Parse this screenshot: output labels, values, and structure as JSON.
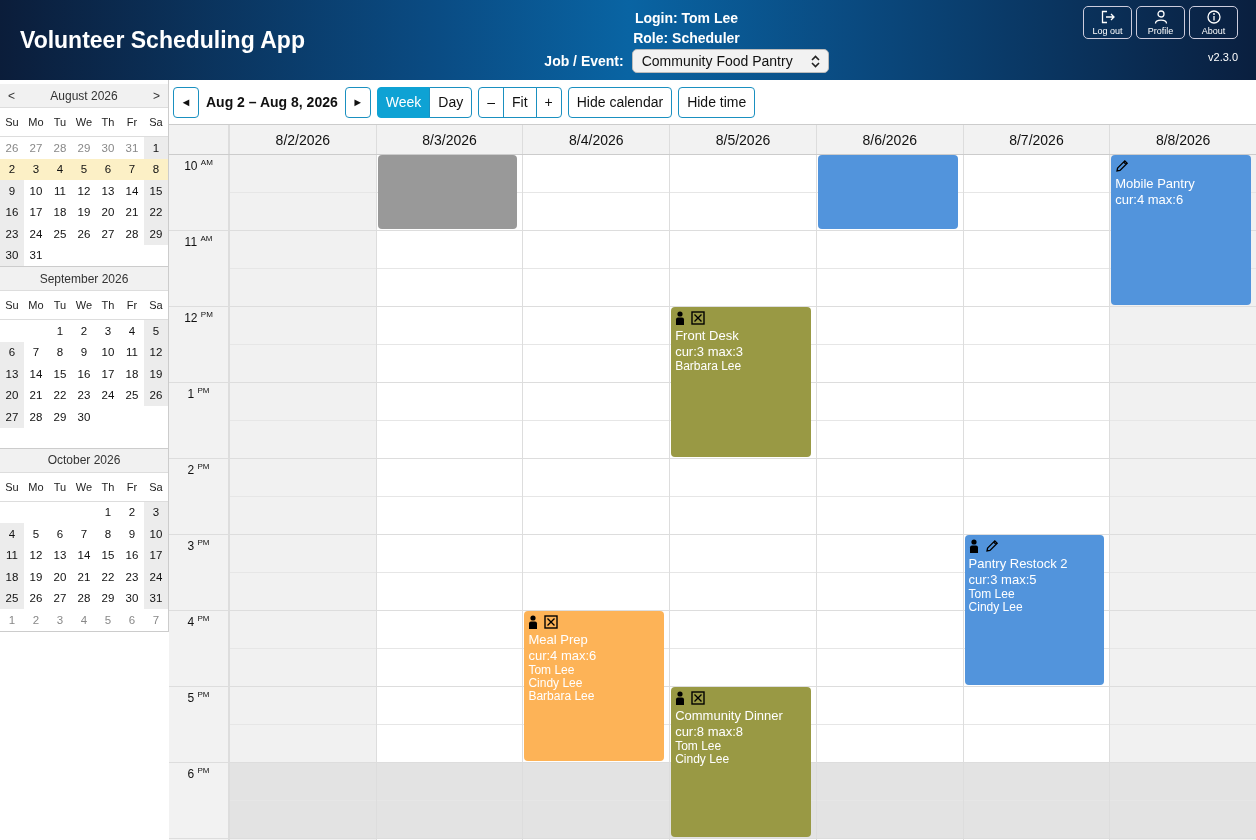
{
  "header": {
    "title": "Volunteer Scheduling App",
    "login": "Login: Tom Lee",
    "role": "Role: Scheduler",
    "job_label": "Job / Event:",
    "job_value": "Community Food Pantry",
    "buttons": [
      {
        "kind": "logout",
        "label": "Log out"
      },
      {
        "kind": "profile",
        "label": "Profile"
      },
      {
        "kind": "about",
        "label": "About"
      }
    ],
    "version": "v2.3.0"
  },
  "mini_calendars": [
    {
      "title": "August 2026",
      "prev": "<",
      "next": ">",
      "weekdays": [
        "Su",
        "Mo",
        "Tu",
        "We",
        "Th",
        "Fr",
        "Sa"
      ],
      "weeks": [
        {
          "selected": false,
          "kind": "week",
          "days": [
            {
              "label": "26",
              "other_month": true
            },
            {
              "label": "27",
              "other_month": true
            },
            {
              "label": "28",
              "other_month": true
            },
            {
              "label": "29",
              "other_month": true
            },
            {
              "label": "30",
              "other_month": true
            },
            {
              "label": "31",
              "other_month": true
            },
            {
              "label": "1",
              "other_month": false
            }
          ]
        },
        {
          "selected": true,
          "kind": "week",
          "days": [
            {
              "label": "2",
              "other_month": false
            },
            {
              "label": "3",
              "other_month": false
            },
            {
              "label": "4",
              "other_month": false
            },
            {
              "label": "5",
              "other_month": false
            },
            {
              "label": "6",
              "other_month": false
            },
            {
              "label": "7",
              "other_month": false
            },
            {
              "label": "8",
              "other_month": false
            }
          ]
        },
        {
          "selected": false,
          "kind": "week",
          "days": [
            {
              "label": "9",
              "other_month": false
            },
            {
              "label": "10",
              "other_month": false
            },
            {
              "label": "11",
              "other_month": false
            },
            {
              "label": "12",
              "other_month": false
            },
            {
              "label": "13",
              "other_month": false
            },
            {
              "label": "14",
              "other_month": false
            },
            {
              "label": "15",
              "other_month": false
            }
          ]
        },
        {
          "selected": false,
          "kind": "week",
          "days": [
            {
              "label": "16",
              "other_month": false
            },
            {
              "label": "17",
              "other_month": false
            },
            {
              "label": "18",
              "other_month": false
            },
            {
              "label": "19",
              "other_month": false
            },
            {
              "label": "20",
              "other_month": false
            },
            {
              "label": "21",
              "other_month": false
            },
            {
              "label": "22",
              "other_month": false
            }
          ]
        },
        {
          "selected": false,
          "kind": "week",
          "days": [
            {
              "label": "23",
              "other_month": false
            },
            {
              "label": "24",
              "other_month": false
            },
            {
              "label": "25",
              "other_month": false
            },
            {
              "label": "26",
              "other_month": false
            },
            {
              "label": "27",
              "other_month": false
            },
            {
              "label": "28",
              "other_month": false
            },
            {
              "label": "29",
              "other_month": false
            }
          ]
        },
        {
          "selected": false,
          "kind": "week",
          "days": [
            {
              "label": "30",
              "other_month": false
            },
            {
              "label": "31",
              "other_month": false
            }
          ]
        }
      ]
    },
    {
      "title": "September 2026",
      "weekdays": [
        "Su",
        "Mo",
        "Tu",
        "We",
        "Th",
        "Fr",
        "Sa"
      ],
      "weeks": [
        {
          "selected": false,
          "kind": "padded",
          "days": [
            {
              "label": "1",
              "other_month": false
            },
            {
              "label": "2",
              "other_month": false
            },
            {
              "label": "3",
              "other_month": false
            },
            {
              "label": "4",
              "other_month": false
            },
            {
              "label": "5",
              "other_month": false
            }
          ]
        },
        {
          "selected": false,
          "kind": "week",
          "days": [
            {
              "label": "6",
              "other_month": false
            },
            {
              "label": "7",
              "other_month": false
            },
            {
              "label": "8",
              "other_month": false
            },
            {
              "label": "9",
              "other_month": false
            },
            {
              "label": "10",
              "other_month": false
            },
            {
              "label": "11",
              "other_month": false
            },
            {
              "label": "12",
              "other_month": false
            }
          ]
        },
        {
          "selected": false,
          "kind": "week",
          "days": [
            {
              "label": "13",
              "other_month": false
            },
            {
              "label": "14",
              "other_month": false
            },
            {
              "label": "15",
              "other_month": false
            },
            {
              "label": "16",
              "other_month": false
            },
            {
              "label": "17",
              "other_month": false
            },
            {
              "label": "18",
              "other_month": false
            },
            {
              "label": "19",
              "other_month": false
            }
          ]
        },
        {
          "selected": false,
          "kind": "week",
          "days": [
            {
              "label": "20",
              "other_month": false
            },
            {
              "label": "21",
              "other_month": false
            },
            {
              "label": "22",
              "other_month": false
            },
            {
              "label": "23",
              "other_month": false
            },
            {
              "label": "24",
              "other_month": false
            },
            {
              "label": "25",
              "other_month": false
            },
            {
              "label": "26",
              "other_month": false
            }
          ]
        },
        {
          "selected": false,
          "kind": "week",
          "days": [
            {
              "label": "27",
              "other_month": false
            },
            {
              "label": "28",
              "other_month": false
            },
            {
              "label": "29",
              "other_month": false
            },
            {
              "label": "30",
              "other_month": false
            }
          ]
        }
      ]
    },
    {
      "title": "October 2026",
      "weekdays": [
        "Su",
        "Mo",
        "Tu",
        "We",
        "Th",
        "Fr",
        "Sa"
      ],
      "weeks": [
        {
          "selected": false,
          "kind": "padded",
          "days": [
            {
              "label": "1",
              "other_month": false
            },
            {
              "label": "2",
              "other_month": false
            },
            {
              "label": "3",
              "other_month": false
            }
          ]
        },
        {
          "selected": false,
          "kind": "week",
          "days": [
            {
              "label": "4",
              "other_month": false
            },
            {
              "label": "5",
              "other_month": false
            },
            {
              "label": "6",
              "other_month": false
            },
            {
              "label": "7",
              "other_month": false
            },
            {
              "label": "8",
              "other_month": false
            },
            {
              "label": "9",
              "other_month": false
            },
            {
              "label": "10",
              "other_month": false
            }
          ]
        },
        {
          "selected": false,
          "kind": "week",
          "days": [
            {
              "label": "11",
              "other_month": false
            },
            {
              "label": "12",
              "other_month": false
            },
            {
              "label": "13",
              "other_month": false
            },
            {
              "label": "14",
              "other_month": false
            },
            {
              "label": "15",
              "other_month": false
            },
            {
              "label": "16",
              "other_month": false
            },
            {
              "label": "17",
              "other_month": false
            }
          ]
        },
        {
          "selected": false,
          "kind": "week",
          "days": [
            {
              "label": "18",
              "other_month": false
            },
            {
              "label": "19",
              "other_month": false
            },
            {
              "label": "20",
              "other_month": false
            },
            {
              "label": "21",
              "other_month": false
            },
            {
              "label": "22",
              "other_month": false
            },
            {
              "label": "23",
              "other_month": false
            },
            {
              "label": "24",
              "other_month": false
            }
          ]
        },
        {
          "selected": false,
          "kind": "week",
          "days": [
            {
              "label": "25",
              "other_month": false
            },
            {
              "label": "26",
              "other_month": false
            },
            {
              "label": "27",
              "other_month": false
            },
            {
              "label": "28",
              "other_month": false
            },
            {
              "label": "29",
              "other_month": false
            },
            {
              "label": "30",
              "other_month": false
            },
            {
              "label": "31",
              "other_month": false
            }
          ]
        },
        {
          "selected": false,
          "kind": "week",
          "days": [
            {
              "label": "1",
              "other_month": true
            },
            {
              "label": "2",
              "other_month": true
            },
            {
              "label": "3",
              "other_month": true
            },
            {
              "label": "4",
              "other_month": true
            },
            {
              "label": "5",
              "other_month": true
            },
            {
              "label": "6",
              "other_month": true
            },
            {
              "label": "7",
              "other_month": true
            }
          ]
        }
      ]
    }
  ],
  "toolbar": {
    "prev": "◄",
    "range": "Aug 2 – Aug 8, 2026",
    "next": "►",
    "views": [
      {
        "label": "Week",
        "selected": true
      },
      {
        "label": "Day",
        "selected": false
      }
    ],
    "zoom": [
      "–",
      "Fit",
      "+"
    ],
    "toggles": [
      "Hide calendar",
      "Hide time"
    ]
  },
  "calendar": {
    "hours": [
      {
        "label": "10 $^{AM}$",
        "off_hours": false
      },
      {
        "label": "11 $^{AM}$",
        "off_hours": false
      },
      {
        "label": "12 $^{PM}$",
        "off_hours": false
      },
      {
        "label": "1 $^{PM}$",
        "off_hours": false
      },
      {
        "label": "2 $^{PM}$",
        "off_hours": false
      },
      {
        "label": "3 $^{PM}$",
        "off_hours": false
      },
      {
        "label": "4 $^{PM}$",
        "off_hours": false
      },
      {
        "label": "5 $^{PM}$",
        "off_hours": false
      },
      {
        "label": "6 $^{PM}$",
        "off_hours": true
      }
    ],
    "days": [
      {
        "label": "8/2/2026",
        "weekend": true,
        "slots": [
          {
            "kind": "free"
          },
          {
            "kind": "free"
          },
          {
            "kind": "free"
          },
          {
            "kind": "free"
          },
          {
            "kind": "free"
          },
          {
            "kind": "free"
          },
          {
            "kind": "free"
          },
          {
            "kind": "free"
          },
          {
            "kind": "free"
          }
        ]
      },
      {
        "label": "8/3/2026",
        "weekend": false,
        "slots": [
          {
            "kind": "event",
            "color": "#999999"
          },
          {
            "kind": "free"
          },
          {
            "kind": "free"
          },
          {
            "kind": "free"
          },
          {
            "kind": "free"
          },
          {
            "kind": "free"
          },
          {
            "kind": "free"
          },
          {
            "kind": "free"
          },
          {
            "kind": "free"
          }
        ]
      },
      {
        "label": "8/4/2026",
        "weekend": false,
        "slots": [
          {
            "kind": "free"
          },
          {
            "kind": "free"
          },
          {
            "kind": "free"
          },
          {
            "kind": "free"
          },
          {
            "kind": "free"
          },
          {
            "kind": "free"
          },
          {
            "kind": "event",
            "color": "#fdb357",
            "signed_up": true,
            "removable": true,
            "editable": false,
            "title": "Meal Prep",
            "counts": "cur:4 max:6",
            "volunteers": [
              "Tom Lee",
              "Cindy Lee",
              "Barbara Lee"
            ]
          },
          {
            "kind": "continued"
          },
          {
            "kind": "free"
          }
        ]
      },
      {
        "label": "8/5/2026",
        "weekend": false,
        "slots": [
          {
            "kind": "free"
          },
          {
            "kind": "free"
          },
          {
            "kind": "event",
            "color": "#999944",
            "signed_up": true,
            "removable": true,
            "editable": false,
            "title": "Front Desk",
            "counts": "cur:3 max:3",
            "volunteers": [
              "Barbara Lee"
            ]
          },
          {
            "kind": "continued"
          },
          {
            "kind": "free"
          },
          {
            "kind": "free"
          },
          {
            "kind": "free"
          },
          {
            "kind": "event",
            "color": "#999944",
            "signed_up": true,
            "removable": true,
            "editable": false,
            "title": "Community Dinner",
            "counts": "cur:8 max:8",
            "volunteers": [
              "Tom Lee",
              "Cindy Lee"
            ]
          },
          {
            "kind": "continued"
          }
        ]
      },
      {
        "label": "8/6/2026",
        "weekend": false,
        "slots": [
          {
            "kind": "event",
            "color": "#5294dc"
          },
          {
            "kind": "free"
          },
          {
            "kind": "free"
          },
          {
            "kind": "free"
          },
          {
            "kind": "free"
          },
          {
            "kind": "free"
          },
          {
            "kind": "free"
          },
          {
            "kind": "free"
          },
          {
            "kind": "free"
          }
        ]
      },
      {
        "label": "8/7/2026",
        "weekend": false,
        "slots": [
          {
            "kind": "free"
          },
          {
            "kind": "free"
          },
          {
            "kind": "free"
          },
          {
            "kind": "free"
          },
          {
            "kind": "free"
          },
          {
            "kind": "event",
            "color": "#5294dc",
            "signed_up": true,
            "removable": false,
            "editable": true,
            "title": "Pantry Restock 2",
            "counts": "cur:3 max:5",
            "volunteers": [
              "Tom Lee",
              "Cindy Lee"
            ]
          },
          {
            "kind": "continued"
          },
          {
            "kind": "free"
          },
          {
            "kind": "free"
          }
        ]
      },
      {
        "label": "8/8/2026",
        "weekend": true,
        "slots": [
          {
            "kind": "event",
            "color": "#5294dc",
            "signed_up": false,
            "removable": false,
            "editable": true,
            "title": "Mobile Pantry",
            "counts": "cur:4 max:6"
          },
          {
            "kind": "continued"
          },
          {
            "kind": "free"
          },
          {
            "kind": "free"
          },
          {
            "kind": "free"
          },
          {
            "kind": "free"
          },
          {
            "kind": "free"
          },
          {
            "kind": "free"
          },
          {
            "kind": "free"
          }
        ]
      }
    ]
  }
}
